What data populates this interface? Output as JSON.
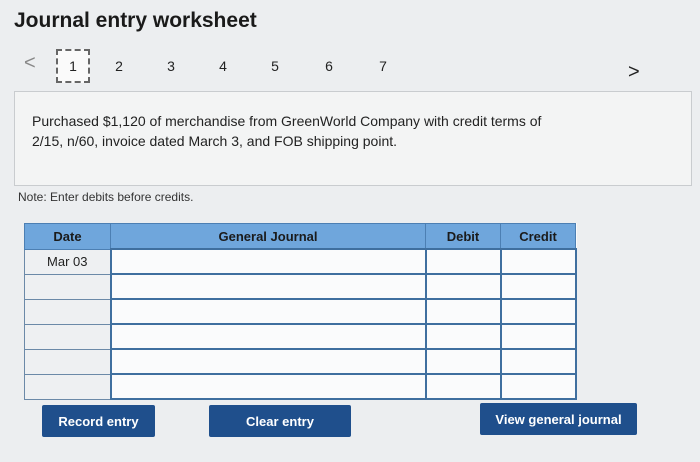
{
  "title": "Journal entry worksheet",
  "nav": {
    "prev_icon": "chevron-left-icon",
    "next_icon": "chevron-right-icon",
    "prev_glyph": "<",
    "next_glyph": ">"
  },
  "pages": [
    "1",
    "2",
    "3",
    "4",
    "5",
    "6",
    "7"
  ],
  "active_page": "1",
  "description": "Purchased $1,120 of merchandise from GreenWorld Company with credit terms of 2/15, n/60, invoice dated March 3, and FOB shipping point.",
  "note": "Note: Enter debits before credits.",
  "table": {
    "headers": {
      "date": "Date",
      "general_journal": "General Journal",
      "debit": "Debit",
      "credit": "Credit"
    },
    "rows": [
      {
        "date": "Mar 03",
        "account": "",
        "debit": "",
        "credit": ""
      },
      {
        "date": "",
        "account": "",
        "debit": "",
        "credit": ""
      },
      {
        "date": "",
        "account": "",
        "debit": "",
        "credit": ""
      },
      {
        "date": "",
        "account": "",
        "debit": "",
        "credit": ""
      },
      {
        "date": "",
        "account": "",
        "debit": "",
        "credit": ""
      },
      {
        "date": "",
        "account": "",
        "debit": "",
        "credit": ""
      }
    ]
  },
  "buttons": {
    "record": "Record entry",
    "clear": "Clear entry",
    "view": "View general journal"
  },
  "colors": {
    "header_blue": "#6fa6dc",
    "button_blue": "#1f4f8c"
  }
}
